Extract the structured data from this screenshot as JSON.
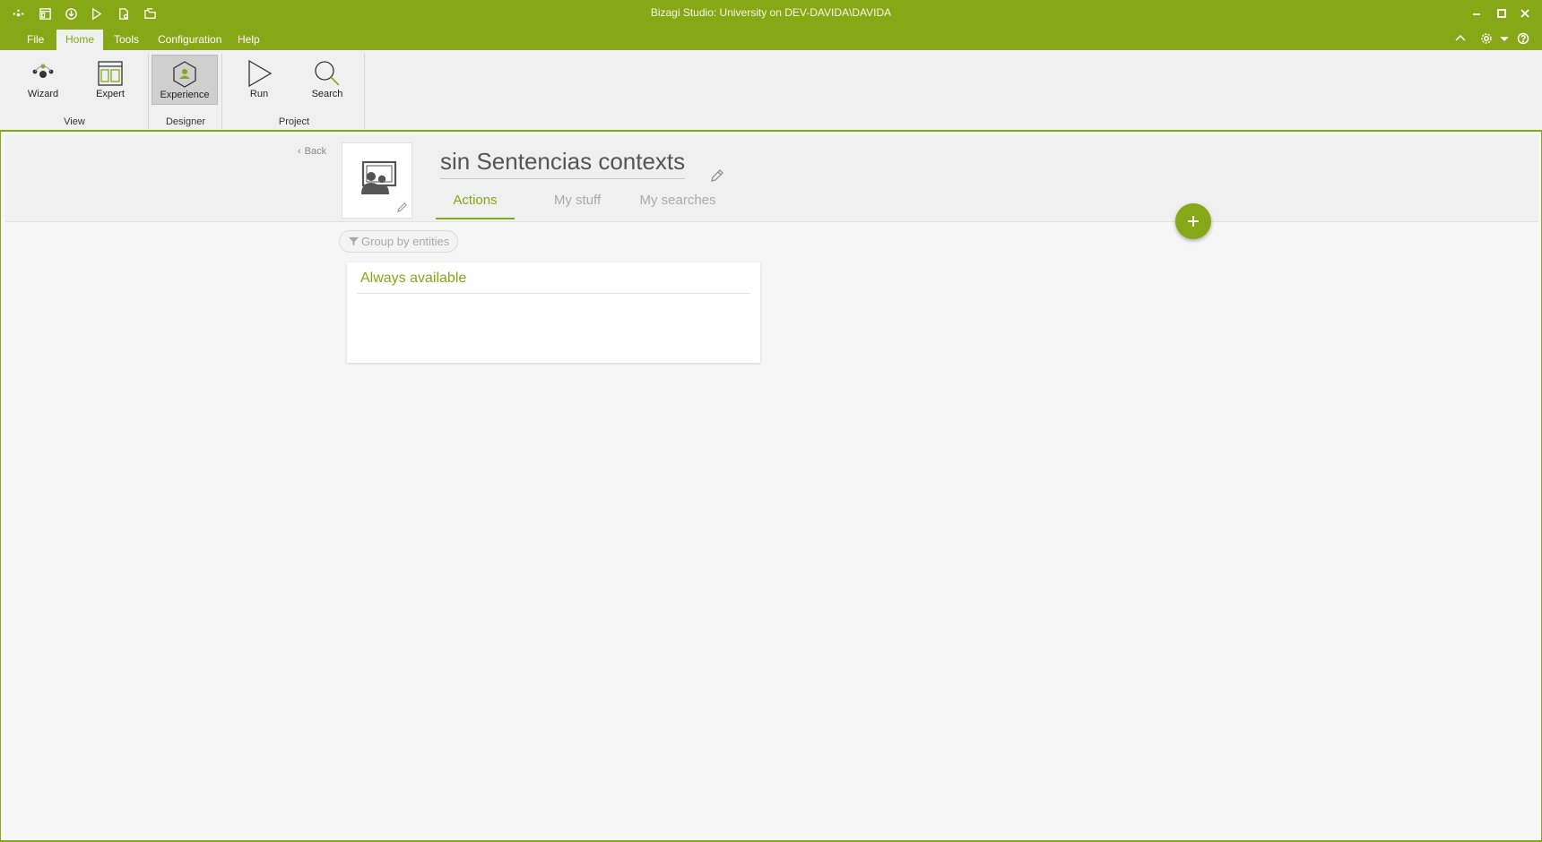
{
  "window": {
    "title": "Bizagi Studio: University  on DEV-DAVIDA\\DAVIDA",
    "quick_access_icons": [
      "bizagi-logo-icon",
      "window-layout-icon",
      "save-icon",
      "run-icon",
      "document-gear-icon",
      "open-folder-icon"
    ],
    "controls": [
      "minimize-icon",
      "maximize-icon",
      "close-icon"
    ]
  },
  "menu": {
    "items": [
      "File",
      "Home",
      "Tools",
      "Configuration",
      "Help"
    ],
    "active": "Home",
    "right_icons": [
      "collapse-ribbon-icon",
      "settings-gear-icon",
      "dropdown-arrow-icon",
      "help-icon"
    ]
  },
  "ribbon": {
    "buttons": {
      "wizard": "Wizard",
      "expert": "Expert",
      "experience": "Experience",
      "run": "Run",
      "search": "Search"
    },
    "groups": {
      "view": "View",
      "designer": "Designer",
      "project": "Project"
    },
    "selected": "Experience"
  },
  "context": {
    "back_label": "Back",
    "title": "sin Sentencias contexts",
    "tabs": [
      "Actions",
      "My stuff",
      "My searches"
    ],
    "active_tab": "Actions",
    "group_by_label": "Group by entities",
    "card": {
      "title": "Always available"
    }
  },
  "colors": {
    "accent": "#86a817",
    "ribbon_bg": "#f0f0f0",
    "content_bg": "#f6f6f6"
  }
}
